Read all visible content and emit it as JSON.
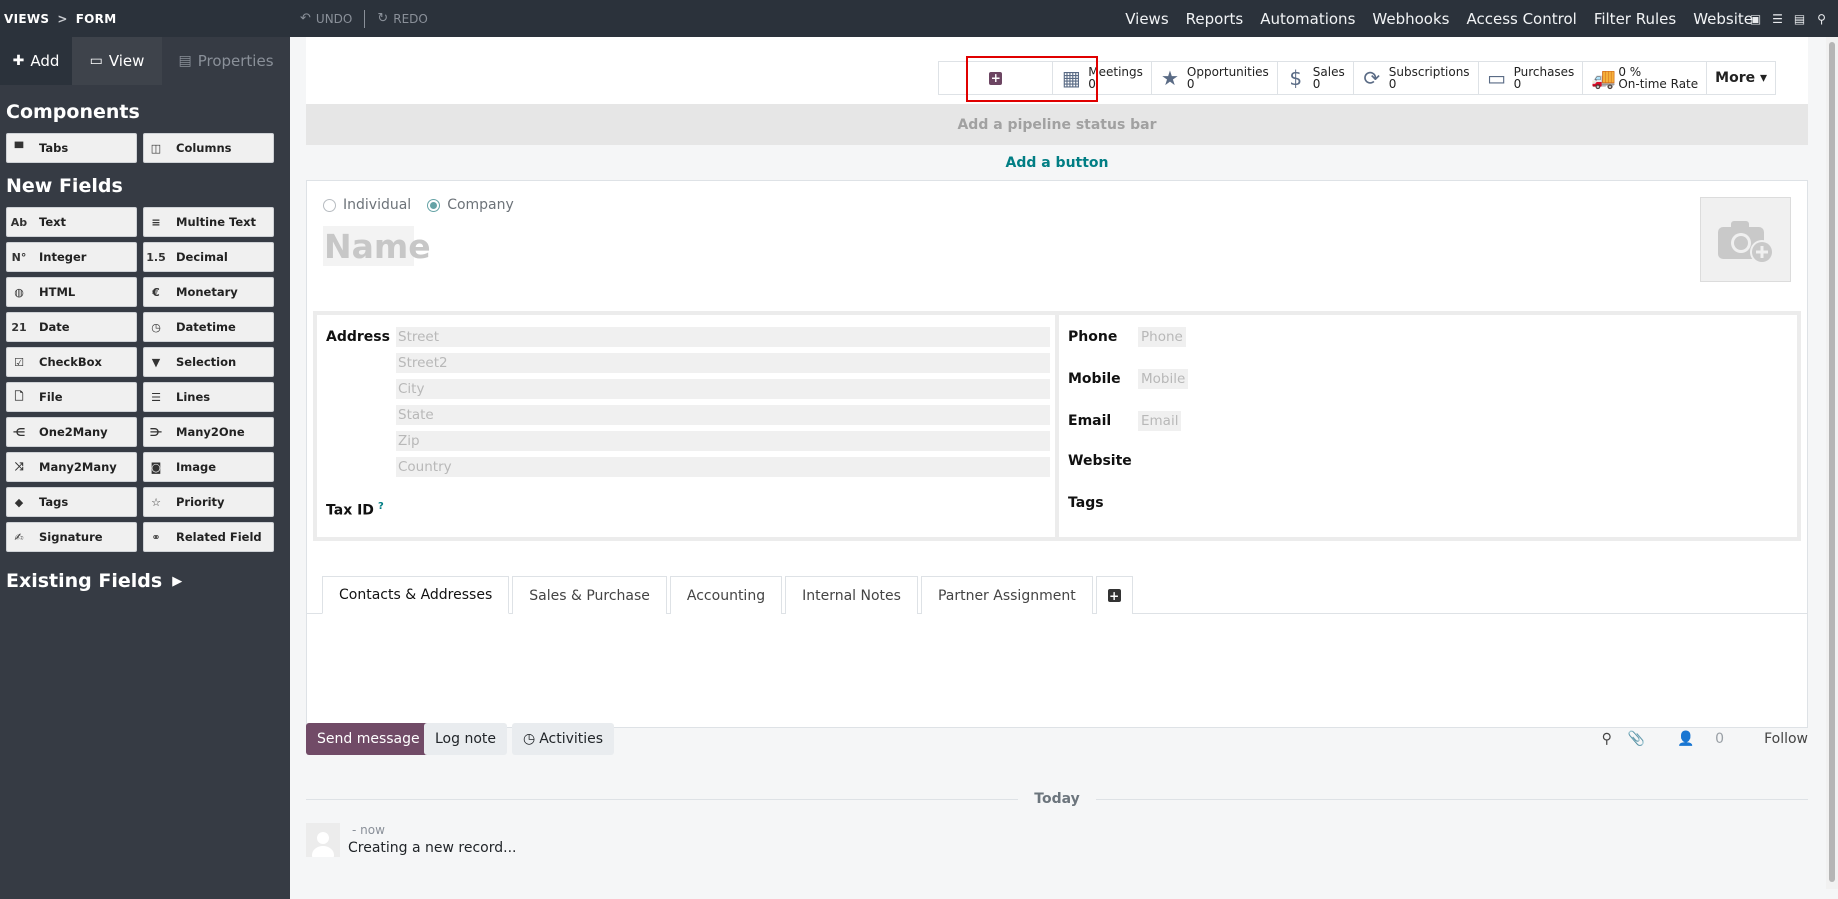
{
  "topbar": {
    "breadcrumb": [
      "VIEWS",
      ">",
      "FORM"
    ],
    "undo": "UNDO",
    "redo": "REDO",
    "menu": [
      "Views",
      "Reports",
      "Automations",
      "Webhooks",
      "Access Control",
      "Filter Rules",
      "Website"
    ],
    "icons": [
      "id-card-icon",
      "list-icon",
      "layout-icon",
      "search-icon"
    ]
  },
  "sidebar": {
    "tabs": {
      "add": "Add",
      "view": "View",
      "properties": "Properties"
    },
    "components_title": "Components",
    "components": [
      {
        "label": "Tabs",
        "icon": "tabs-icon",
        "glyph": "▀"
      },
      {
        "label": "Columns",
        "icon": "columns-icon",
        "glyph": "◫"
      }
    ],
    "new_fields_title": "New Fields",
    "fields": [
      {
        "label": "Text",
        "icon": "text-icon",
        "glyph": "Ab"
      },
      {
        "label": "Multine Text",
        "icon": "multiline-text-icon",
        "glyph": "≡"
      },
      {
        "label": "Integer",
        "icon": "integer-icon",
        "glyph": "N°"
      },
      {
        "label": "Decimal",
        "icon": "decimal-icon",
        "glyph": "1.5"
      },
      {
        "label": "HTML",
        "icon": "html-icon",
        "glyph": "◍"
      },
      {
        "label": "Monetary",
        "icon": "monetary-icon",
        "glyph": "€"
      },
      {
        "label": "Date",
        "icon": "date-icon",
        "glyph": "21"
      },
      {
        "label": "Datetime",
        "icon": "datetime-icon",
        "glyph": "◷"
      },
      {
        "label": "CheckBox",
        "icon": "checkbox-icon",
        "glyph": "☑"
      },
      {
        "label": "Selection",
        "icon": "selection-icon",
        "glyph": "▼"
      },
      {
        "label": "File",
        "icon": "file-icon",
        "glyph": "🗋"
      },
      {
        "label": "Lines",
        "icon": "lines-icon",
        "glyph": "☰"
      },
      {
        "label": "One2Many",
        "icon": "one2many-icon",
        "glyph": "⋲"
      },
      {
        "label": "Many2One",
        "icon": "many2one-icon",
        "glyph": "⋺"
      },
      {
        "label": "Many2Many",
        "icon": "many2many-icon",
        "glyph": "⤨"
      },
      {
        "label": "Image",
        "icon": "image-icon",
        "glyph": "◙"
      },
      {
        "label": "Tags",
        "icon": "tags-icon",
        "glyph": "◆"
      },
      {
        "label": "Priority",
        "icon": "priority-icon",
        "glyph": "☆"
      },
      {
        "label": "Signature",
        "icon": "signature-icon",
        "glyph": "✍"
      },
      {
        "label": "Related Field",
        "icon": "related-field-icon",
        "glyph": "⚭"
      }
    ],
    "existing_fields_title": "Existing Fields"
  },
  "smart_buttons": [
    {
      "label": "Meetings",
      "value": "0",
      "icon": "calendar-icon",
      "glyph": "▦"
    },
    {
      "label": "Opportunities",
      "value": "0",
      "icon": "star-icon",
      "glyph": "★"
    },
    {
      "label": "Sales",
      "value": "0",
      "icon": "dollar-icon",
      "glyph": "$"
    },
    {
      "label": "Subscriptions",
      "value": "0",
      "icon": "refresh-icon",
      "glyph": "⟳"
    },
    {
      "label": "Purchases",
      "value": "0",
      "icon": "credit-card-icon",
      "glyph": "▭"
    },
    {
      "label": "0 %",
      "value": "On-time Rate",
      "icon": "truck-icon",
      "glyph": "🚚"
    }
  ],
  "more_label": "More",
  "pipeline_label": "Add a pipeline status bar",
  "add_button_label": "Add a button",
  "form": {
    "radio_individual": "Individual",
    "radio_company": "Company",
    "name_placeholder": "Name",
    "address_label": "Address",
    "address_fields": [
      "Street",
      "Street2",
      "City",
      "State",
      "Zip",
      "Country"
    ],
    "tax_id_label": "Tax ID",
    "tax_id_help": "?",
    "right_fields": [
      {
        "label": "Phone",
        "placeholder": "Phone"
      },
      {
        "label": "Mobile",
        "placeholder": "Mobile"
      },
      {
        "label": "Email",
        "placeholder": "Email"
      },
      {
        "label": "Website",
        "placeholder": ""
      },
      {
        "label": "Tags",
        "placeholder": ""
      }
    ]
  },
  "notebook_tabs": [
    "Contacts & Addresses",
    "Sales & Purchase",
    "Accounting",
    "Internal Notes",
    "Partner Assignment"
  ],
  "chatter": {
    "send_message": "Send message",
    "log_note": "Log note",
    "activities": "Activities",
    "followers_count": "0",
    "follow": "Follow",
    "today": "Today",
    "message_meta": "- now",
    "message_body": "Creating a new record..."
  },
  "colors": {
    "topbar_bg": "#2b323b",
    "sidebar_bg": "#363b44",
    "primary": "#714b67",
    "link_teal": "#017e84",
    "highlight": "#e00000"
  }
}
